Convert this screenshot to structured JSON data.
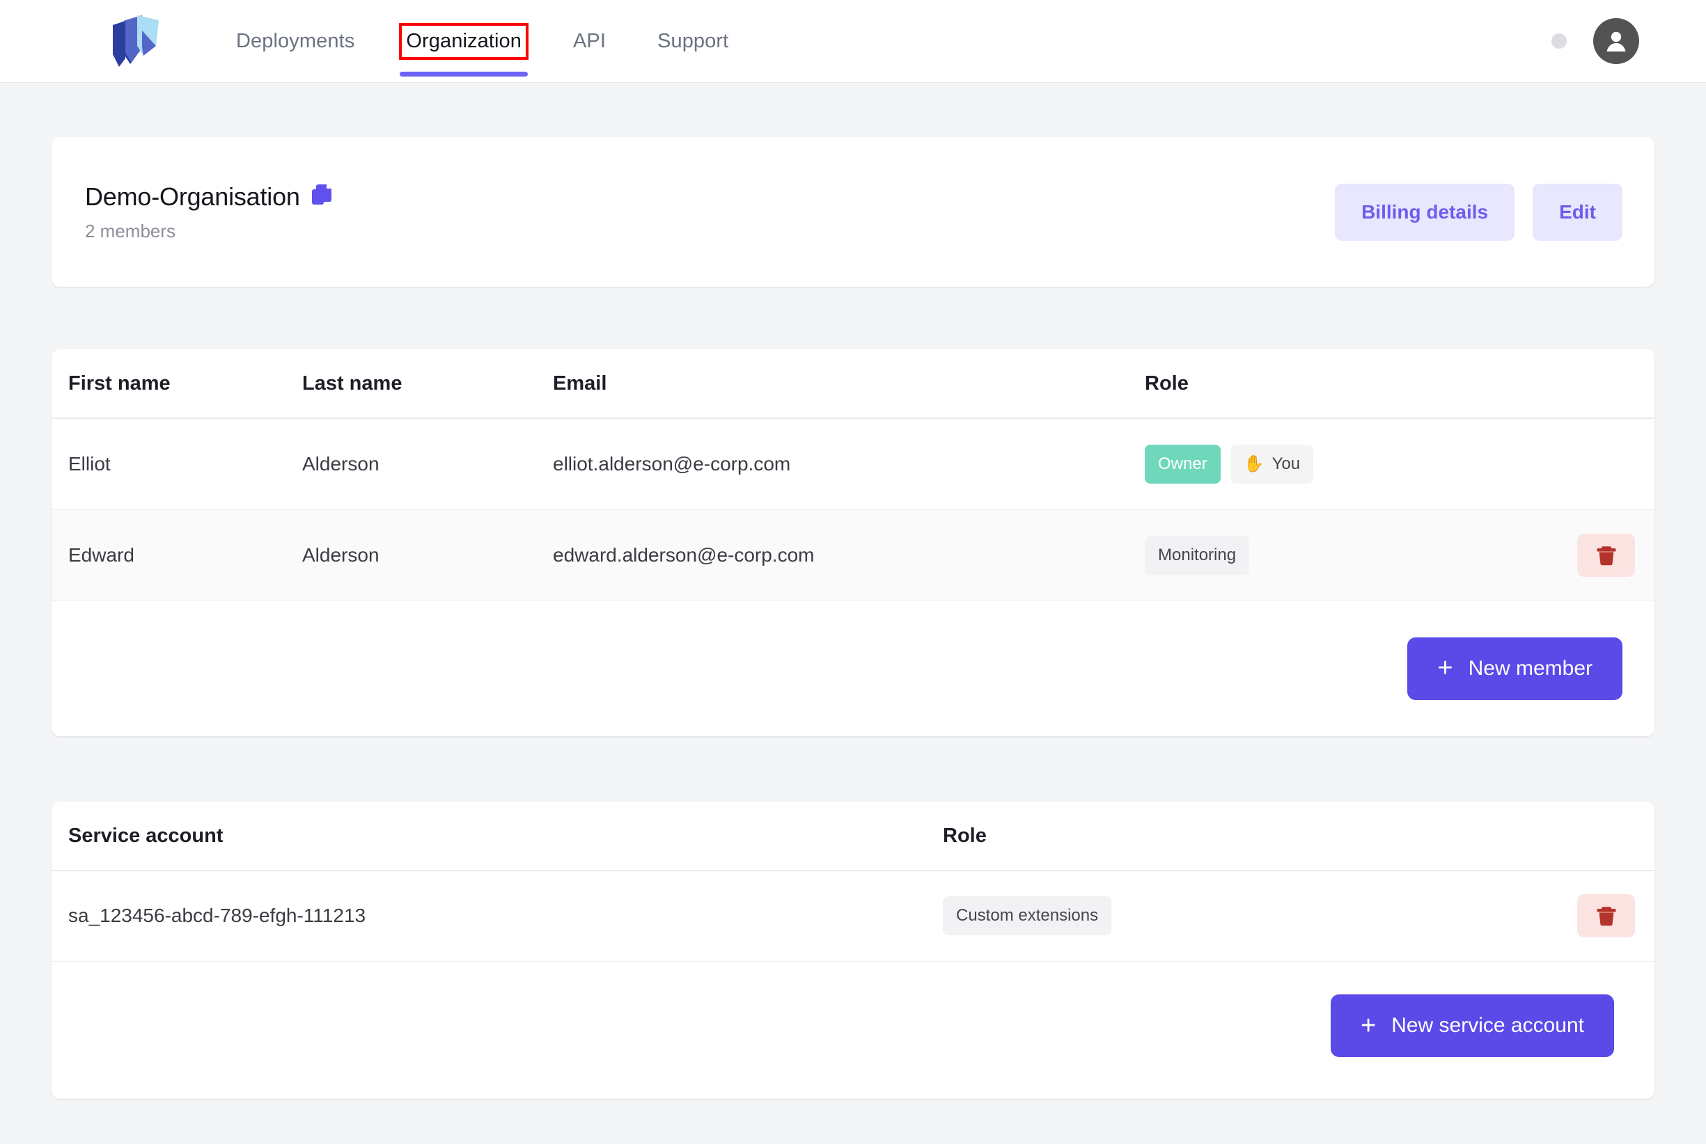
{
  "header": {
    "logo_icon": "layered-shield-logo",
    "nav": [
      {
        "label": "Deployments",
        "active": false,
        "annotated": false
      },
      {
        "label": "Organization",
        "active": true,
        "annotated": true
      },
      {
        "label": "API",
        "active": false,
        "annotated": false
      },
      {
        "label": "Support",
        "active": false,
        "annotated": false
      }
    ],
    "status_dot_color": "#dcdde0",
    "avatar_icon": "user-avatar-icon"
  },
  "org": {
    "name": "Demo-Organisation",
    "copy_icon": "copy-icon",
    "members_count_label": "2 members",
    "billing_button_label": "Billing details",
    "edit_button_label": "Edit"
  },
  "members_table": {
    "columns": [
      "First name",
      "Last name",
      "Email",
      "Role",
      ""
    ],
    "rows": [
      {
        "first_name": "Elliot",
        "last_name": "Alderson",
        "email": "elliot.alderson@e-corp.com",
        "badges": [
          {
            "text": "Owner",
            "style": "owner"
          },
          {
            "text": "You",
            "style": "you",
            "emoji": "✋"
          }
        ],
        "deletable": false
      },
      {
        "first_name": "Edward",
        "last_name": "Alderson",
        "email": "edward.alderson@e-corp.com",
        "badges": [
          {
            "text": "Monitoring",
            "style": "grey"
          }
        ],
        "deletable": true
      }
    ],
    "new_member_button_label": "New member",
    "new_member_plus": "+"
  },
  "service_accounts_table": {
    "columns": [
      "Service account",
      "Role",
      ""
    ],
    "rows": [
      {
        "account_id": "sa_123456-abcd-789-efgh-111213",
        "role": "Custom extensions",
        "deletable": true
      }
    ],
    "new_service_account_button_label": "New service account",
    "new_service_account_plus": "+"
  },
  "colors": {
    "accent_purple": "#5b4ae8",
    "accent_purple_soft_bg": "#e8e7fd",
    "accent_purple_soft_text": "#6d5df0",
    "owner_green": "#6fd8bb",
    "danger_red": "#b4332a",
    "danger_red_bg": "#fae3e1",
    "annotation_red": "#fe0000",
    "page_bg": "#f4f5f7"
  }
}
